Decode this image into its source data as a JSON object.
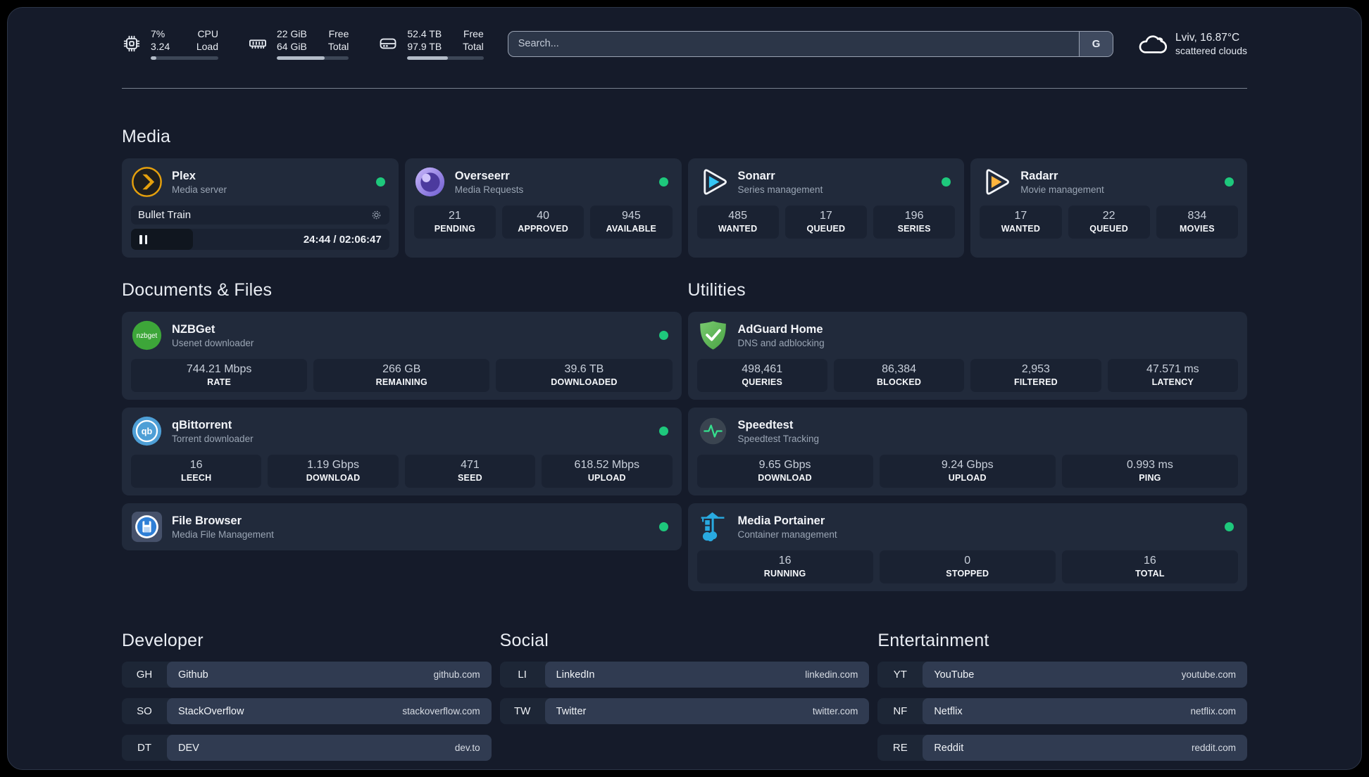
{
  "header": {
    "cpu": {
      "value_top": "7%",
      "value_bottom": "3.24",
      "label_top": "CPU",
      "label_bottom": "Load",
      "progress": 8
    },
    "ram": {
      "value_top": "22 GiB",
      "value_bottom": "64 GiB",
      "label_top": "Free",
      "label_bottom": "Total",
      "progress": 66
    },
    "disk": {
      "value_top": "52.4 TB",
      "value_bottom": "97.9 TB",
      "label_top": "Free",
      "label_bottom": "Total",
      "progress": 53
    },
    "search": {
      "placeholder": "Search...",
      "button_label": "G"
    },
    "weather": {
      "location_temp": "Lviv, 16.87°C",
      "condition": "scattered clouds"
    }
  },
  "media": {
    "title": "Media",
    "plex": {
      "title": "Plex",
      "subtitle": "Media server",
      "now_playing": {
        "title": "Bullet Train",
        "time": "24:44 / 02:06:47",
        "progress": 24
      }
    },
    "overseerr": {
      "title": "Overseerr",
      "subtitle": "Media Requests",
      "stats": [
        {
          "value": "21",
          "label": "PENDING"
        },
        {
          "value": "40",
          "label": "APPROVED"
        },
        {
          "value": "945",
          "label": "AVAILABLE"
        }
      ]
    },
    "sonarr": {
      "title": "Sonarr",
      "subtitle": "Series management",
      "stats": [
        {
          "value": "485",
          "label": "WANTED"
        },
        {
          "value": "17",
          "label": "QUEUED"
        },
        {
          "value": "196",
          "label": "SERIES"
        }
      ]
    },
    "radarr": {
      "title": "Radarr",
      "subtitle": "Movie management",
      "stats": [
        {
          "value": "17",
          "label": "WANTED"
        },
        {
          "value": "22",
          "label": "QUEUED"
        },
        {
          "value": "834",
          "label": "MOVIES"
        }
      ]
    }
  },
  "documents": {
    "title": "Documents & Files",
    "nzbget": {
      "title": "NZBGet",
      "subtitle": "Usenet downloader",
      "stats": [
        {
          "value": "744.21 Mbps",
          "label": "RATE"
        },
        {
          "value": "266 GB",
          "label": "REMAINING"
        },
        {
          "value": "39.6 TB",
          "label": "DOWNLOADED"
        }
      ]
    },
    "qbittorrent": {
      "title": "qBittorrent",
      "subtitle": "Torrent downloader",
      "stats": [
        {
          "value": "16",
          "label": "LEECH"
        },
        {
          "value": "1.19 Gbps",
          "label": "DOWNLOAD"
        },
        {
          "value": "471",
          "label": "SEED"
        },
        {
          "value": "618.52 Mbps",
          "label": "UPLOAD"
        }
      ]
    },
    "filebrowser": {
      "title": "File Browser",
      "subtitle": "Media File Management"
    }
  },
  "utilities": {
    "title": "Utilities",
    "adguard": {
      "title": "AdGuard Home",
      "subtitle": "DNS and adblocking",
      "stats": [
        {
          "value": "498,461",
          "label": "QUERIES"
        },
        {
          "value": "86,384",
          "label": "BLOCKED"
        },
        {
          "value": "2,953",
          "label": "FILTERED"
        },
        {
          "value": "47.571 ms",
          "label": "LATENCY"
        }
      ]
    },
    "speedtest": {
      "title": "Speedtest",
      "subtitle": "Speedtest Tracking",
      "stats": [
        {
          "value": "9.65 Gbps",
          "label": "DOWNLOAD"
        },
        {
          "value": "9.24 Gbps",
          "label": "UPLOAD"
        },
        {
          "value": "0.993 ms",
          "label": "PING"
        }
      ]
    },
    "portainer": {
      "title": "Media Portainer",
      "subtitle": "Container management",
      "stats": [
        {
          "value": "16",
          "label": "RUNNING"
        },
        {
          "value": "0",
          "label": "STOPPED"
        },
        {
          "value": "16",
          "label": "TOTAL"
        }
      ]
    }
  },
  "bookmarks": {
    "developer": {
      "title": "Developer",
      "items": [
        {
          "abbr": "GH",
          "name": "Github",
          "url": "github.com"
        },
        {
          "abbr": "SO",
          "name": "StackOverflow",
          "url": "stackoverflow.com"
        },
        {
          "abbr": "DT",
          "name": "DEV",
          "url": "dev.to"
        }
      ]
    },
    "social": {
      "title": "Social",
      "items": [
        {
          "abbr": "LI",
          "name": "LinkedIn",
          "url": "linkedin.com"
        },
        {
          "abbr": "TW",
          "name": "Twitter",
          "url": "twitter.com"
        }
      ]
    },
    "entertainment": {
      "title": "Entertainment",
      "items": [
        {
          "abbr": "YT",
          "name": "YouTube",
          "url": "youtube.com"
        },
        {
          "abbr": "NF",
          "name": "Netflix",
          "url": "netflix.com"
        },
        {
          "abbr": "RE",
          "name": "Reddit",
          "url": "reddit.com"
        }
      ]
    }
  }
}
